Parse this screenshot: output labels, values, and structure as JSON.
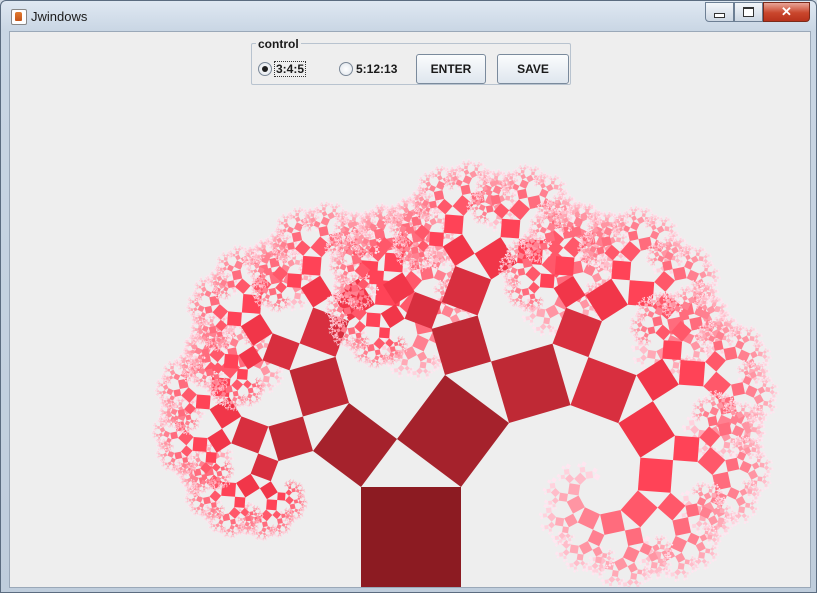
{
  "window": {
    "title": "Jwindows",
    "app_icon": "java-cup-icon"
  },
  "caption_buttons": {
    "minimize_icon": "minimize-icon",
    "maximize_icon": "maximize-icon",
    "close_icon": "close-icon",
    "close_glyph": "✕"
  },
  "control": {
    "legend": "control",
    "options": [
      {
        "label": "3:4:5",
        "selected": true
      },
      {
        "label": "5:12:13",
        "selected": false
      }
    ],
    "enter_label": "ENTER",
    "save_label": "SAVE"
  },
  "fractal": {
    "name": "pythagoras-tree",
    "ratio": "3:4:5",
    "trunk_color": "#8c1b22",
    "mid_color": "#ff3a4e",
    "tip_color": "#ffe6f0"
  }
}
